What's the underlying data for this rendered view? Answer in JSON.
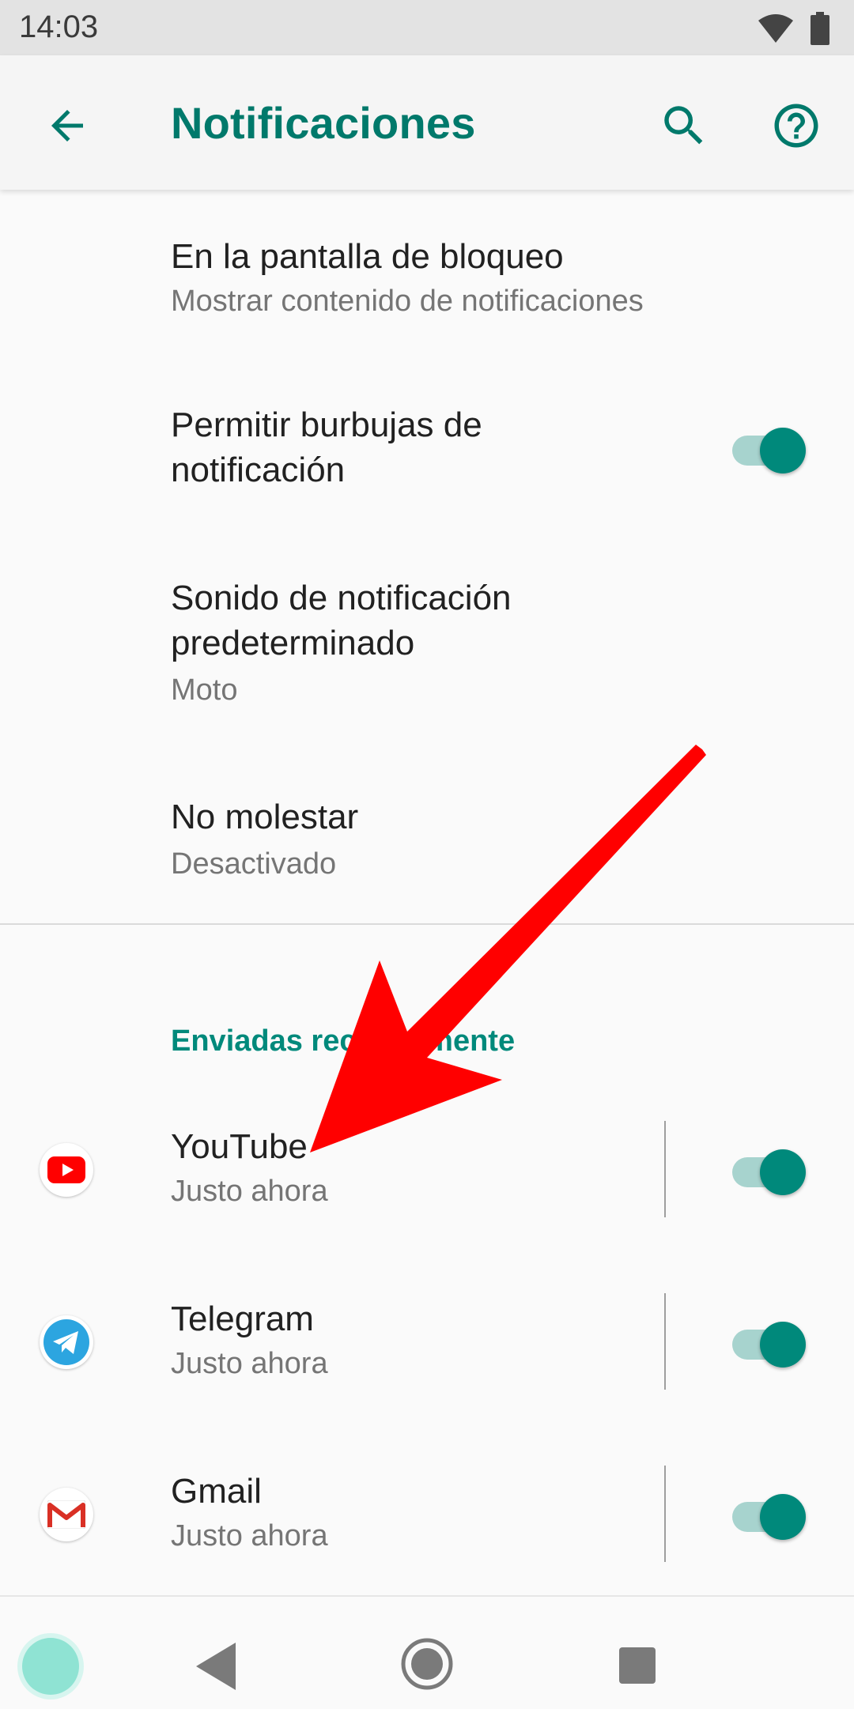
{
  "status_bar": {
    "time": "14:03"
  },
  "app_bar": {
    "title": "Notificaciones"
  },
  "settings": [
    {
      "title": "En la pantalla de bloqueo",
      "subtitle": "Mostrar contenido de notificaciones"
    },
    {
      "title_line1": "Permitir burbujas de",
      "title_line2": "notificación",
      "toggle_on": true
    },
    {
      "title_line1": "Sonido de notificación",
      "title_line2": "predeterminado",
      "subtitle": "Moto"
    },
    {
      "title": "No molestar",
      "subtitle": "Desactivado"
    }
  ],
  "recent_section": {
    "header": "Enviadas recientemente",
    "apps": [
      {
        "name": "YouTube",
        "time": "Justo ahora",
        "icon": "youtube-icon",
        "toggle_on": true
      },
      {
        "name": "Telegram",
        "time": "Justo ahora",
        "icon": "telegram-icon",
        "toggle_on": true
      },
      {
        "name": "Gmail",
        "time": "Justo ahora",
        "icon": "gmail-icon",
        "toggle_on": true
      }
    ]
  },
  "colors": {
    "accent": "#00796b",
    "toggle_thumb": "#00897b",
    "toggle_track": "#a7d3ce",
    "annotation_arrow": "#ff0000"
  }
}
